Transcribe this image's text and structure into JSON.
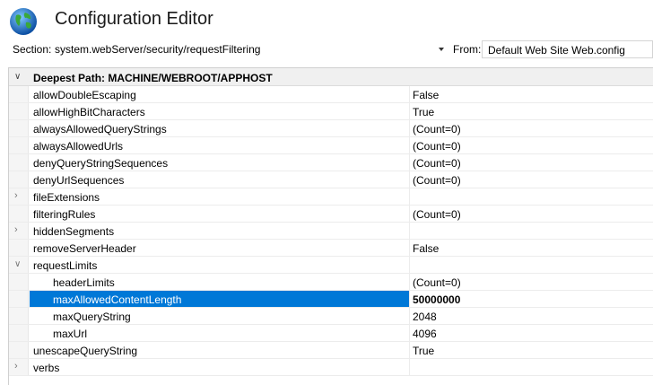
{
  "window": {
    "title": "Configuration Editor"
  },
  "toolbar": {
    "section_label": "Section:",
    "section_value": "system.webServer/security/requestFiltering",
    "from_label": "From:",
    "from_value": "Default Web Site Web.config"
  },
  "grid": {
    "category": "Deepest Path: MACHINE/WEBROOT/APPHOST",
    "rows": [
      {
        "name": "allowDoubleEscaping",
        "value": "False"
      },
      {
        "name": "allowHighBitCharacters",
        "value": "True"
      },
      {
        "name": "alwaysAllowedQueryStrings",
        "value": "(Count=0)"
      },
      {
        "name": "alwaysAllowedUrls",
        "value": "(Count=0)"
      },
      {
        "name": "denyQueryStringSequences",
        "value": "(Count=0)"
      },
      {
        "name": "denyUrlSequences",
        "value": "(Count=0)"
      },
      {
        "name": "fileExtensions",
        "value": ""
      },
      {
        "name": "filteringRules",
        "value": "(Count=0)"
      },
      {
        "name": "hiddenSegments",
        "value": ""
      },
      {
        "name": "removeServerHeader",
        "value": "False"
      },
      {
        "name": "requestLimits",
        "value": ""
      },
      {
        "name": "headerLimits",
        "value": "(Count=0)"
      },
      {
        "name": "maxAllowedContentLength",
        "value": "50000000"
      },
      {
        "name": "maxQueryString",
        "value": "2048"
      },
      {
        "name": "maxUrl",
        "value": "4096"
      },
      {
        "name": "unescapeQueryString",
        "value": "True"
      },
      {
        "name": "verbs",
        "value": ""
      }
    ]
  },
  "colors": {
    "selection": "#0078d7"
  }
}
